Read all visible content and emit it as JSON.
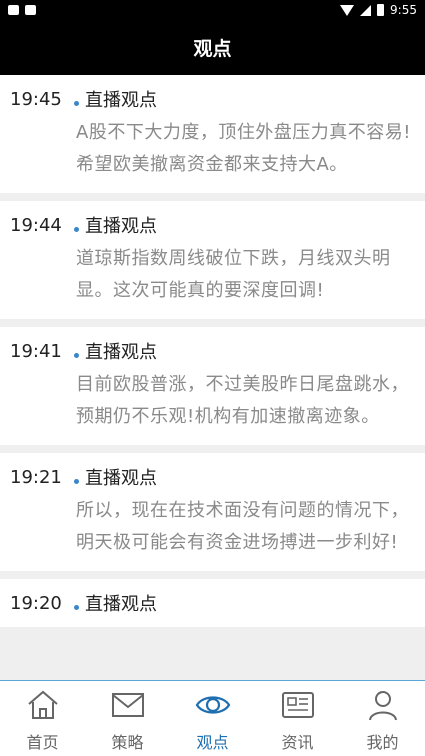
{
  "status_bar": {
    "time": "9:55"
  },
  "header": {
    "title": "观点"
  },
  "feed": [
    {
      "time": "19:45",
      "tag": "直播观点",
      "content": "A股不下大力度，顶住外盘压力真不容易!希望欧美撤离资金都来支持大A。"
    },
    {
      "time": "19:44",
      "tag": "直播观点",
      "content": "道琼斯指数周线破位下跌，月线双头明显。这次可能真的要深度回调!"
    },
    {
      "time": "19:41",
      "tag": "直播观点",
      "content": "目前欧股普涨，不过美股昨日尾盘跳水，预期仍不乐观!机构有加速撤离迹象。"
    },
    {
      "time": "19:21",
      "tag": "直播观点",
      "content": "所以，现在在技术面没有问题的情况下，明天极可能会有资金进场搏进一步利好!"
    },
    {
      "time": "19:20",
      "tag": "直播观点",
      "content": ""
    }
  ],
  "tabs": [
    {
      "label": "首页",
      "icon": "home-icon",
      "active": false
    },
    {
      "label": "策略",
      "icon": "mail-icon",
      "active": false
    },
    {
      "label": "观点",
      "icon": "eye-icon",
      "active": true
    },
    {
      "label": "资讯",
      "icon": "news-icon",
      "active": false
    },
    {
      "label": "我的",
      "icon": "user-icon",
      "active": false
    }
  ],
  "colors": {
    "accent": "#1f6fb0",
    "dot": "#3a86c8",
    "header_bg": "#000000",
    "text_muted": "#8a8a8a"
  }
}
